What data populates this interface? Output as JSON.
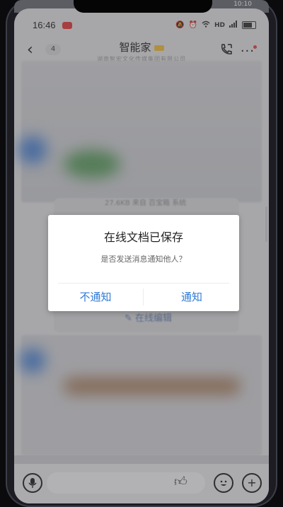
{
  "status_bar": {
    "time": "16:46",
    "network": "HD",
    "top_ghost_time": "10:10"
  },
  "nav": {
    "back_count": "4",
    "title": "智能家",
    "subtitle": "湖南智宏文化传媒集团有限公司"
  },
  "background": {
    "faint_line": "27.6KB  来自 百宝箱 系统",
    "online_edit": "在线编辑"
  },
  "dialog": {
    "title": "在线文档已保存",
    "message": "是否发送消息通知他人？",
    "cancel_label": "不通知",
    "confirm_label": "通知",
    "accent_color": "#2f7ad6"
  },
  "bottom_bar": {
    "voice_icon": "microphone-icon",
    "like_icon": "thumbs-up-icon",
    "emoji_icon": "emoji-icon",
    "add_icon": "plus-icon"
  }
}
